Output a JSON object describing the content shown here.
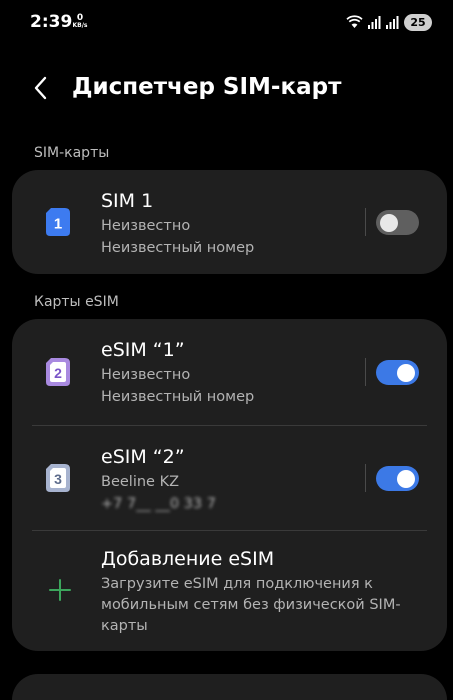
{
  "status_bar": {
    "time": "2:39",
    "speed_value": "0",
    "speed_unit": "KB/s",
    "battery": "25"
  },
  "header": {
    "title": "Диспетчер SIM-карт"
  },
  "sections": {
    "sim_cards": "SIM-карты",
    "esim_cards": "Карты eSIM"
  },
  "sim1": {
    "icon_number": "1",
    "icon_color": "#3d7bf0",
    "title": "SIM 1",
    "operator": "Неизвестно",
    "number": "Неизвестный номер",
    "enabled": false
  },
  "esim1": {
    "icon_number": "2",
    "icon_color": "#a98ae0",
    "title": "eSIM “1”",
    "operator": "Неизвестно",
    "number": "Неизвестный номер",
    "enabled": true
  },
  "esim2": {
    "icon_number": "3",
    "icon_color": "#a7b3cf",
    "title": "eSIM “2”",
    "operator": "Beeline KZ",
    "number": "+7 7__ __0 33 7",
    "enabled": true
  },
  "add_esim": {
    "title": "Добавление eSIM",
    "description": "Загрузите eSIM для подключения к мобильным сетям без физической SIM-карты",
    "icon_color": "#3ca55c"
  },
  "colors": {
    "accent": "#3c79e6",
    "card": "#1f1f1f",
    "background": "#000000"
  }
}
